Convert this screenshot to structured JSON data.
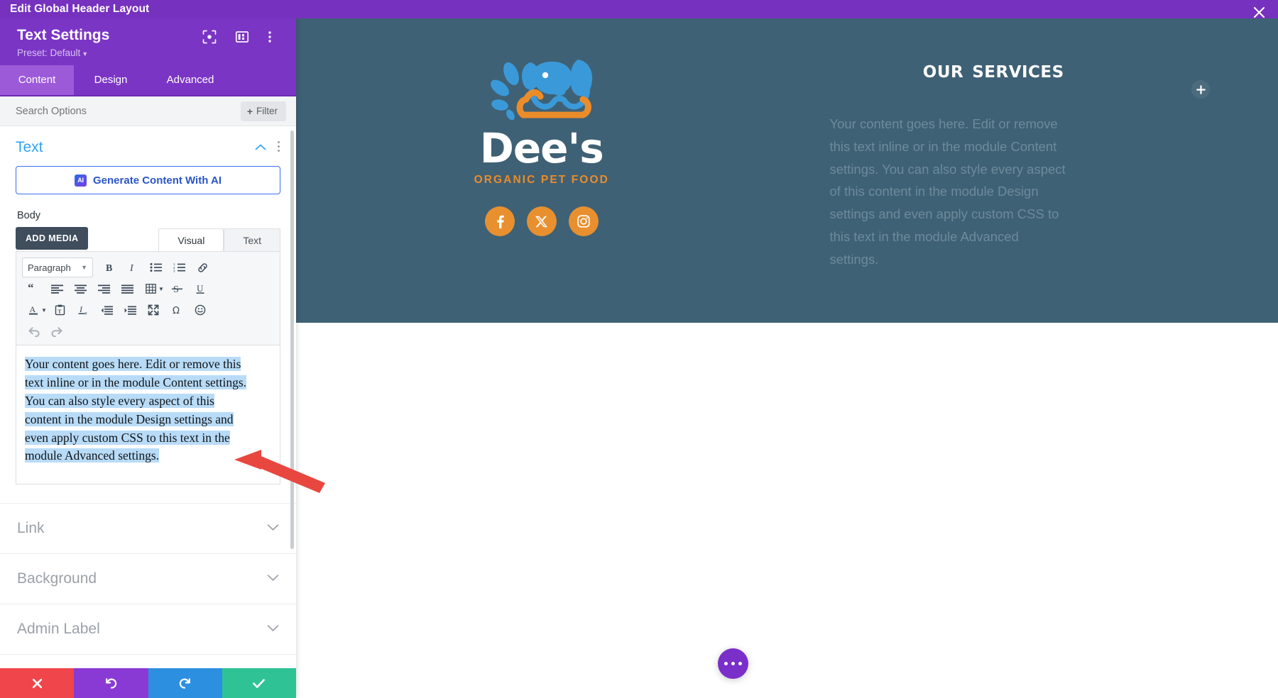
{
  "window": {
    "title": "Edit Global Header Layout",
    "close_icon": "close-icon"
  },
  "panel": {
    "module_title": "Text Settings",
    "preset_label": "Preset: Default",
    "header_icons": [
      "target-icon",
      "layout-columns-icon",
      "kebab-menu-icon"
    ],
    "tabs": [
      {
        "label": "Content",
        "active": true
      },
      {
        "label": "Design",
        "active": false
      },
      {
        "label": "Advanced",
        "active": false
      }
    ],
    "search": {
      "placeholder": "Search Options",
      "filter_label": "Filter"
    },
    "section": {
      "title": "Text",
      "collapse_icon": "chevron-up-icon",
      "options_icon": "kebab-menu-icon"
    },
    "ai_button": {
      "badge": "AI",
      "label": "Generate Content With AI"
    },
    "body_label": "Body",
    "editor": {
      "add_media_label": "ADD MEDIA",
      "tabs": [
        {
          "label": "Visual",
          "selected": true
        },
        {
          "label": "Text",
          "selected": false
        }
      ],
      "format_select": "Paragraph",
      "toolbar_row1": [
        "bold-icon",
        "italic-icon",
        "bulleted-list-icon",
        "numbered-list-icon",
        "link-icon"
      ],
      "toolbar_row2": [
        "blockquote-icon",
        "align-left-icon",
        "align-center-icon",
        "align-right-icon",
        "align-justify-icon",
        "table-icon",
        "strikethrough-icon",
        "underline-icon"
      ],
      "toolbar_row3": [
        "text-color-icon",
        "paste-as-text-icon",
        "clear-formatting-icon",
        "outdent-icon",
        "indent-icon",
        "fullscreen-icon",
        "special-character-icon",
        "emoji-icon"
      ],
      "toolbar_row4": [
        "undo-icon",
        "redo-icon"
      ],
      "content": "Your content goes here. Edit or remove this text inline or in the module Content settings. You can also style every aspect of this content in the module Design settings and even apply custom CSS to this text in the module Advanced settings."
    },
    "accordion": [
      {
        "label": "Link",
        "icon": "chevron-down-icon"
      },
      {
        "label": "Background",
        "icon": "chevron-down-icon"
      },
      {
        "label": "Admin Label",
        "icon": "chevron-down-icon"
      }
    ],
    "footer": [
      {
        "name": "cancel",
        "icon": "x-icon",
        "color": "#f0454b"
      },
      {
        "name": "undo",
        "icon": "undo-icon",
        "color": "#8a3ad4"
      },
      {
        "name": "redo",
        "icon": "redo-icon",
        "color": "#2d8fe0"
      },
      {
        "name": "save",
        "icon": "check-icon",
        "color": "#2fc295"
      }
    ]
  },
  "canvas": {
    "hero_bg": "#3f6175",
    "logo": {
      "wordmark": "Dee's",
      "tagline": "ORGANIC PET FOOD",
      "accent": "#eb8c2a",
      "mark_color": "#3a9ad9"
    },
    "socials": [
      {
        "name": "facebook",
        "glyph": "f"
      },
      {
        "name": "x-twitter",
        "glyph": "X"
      },
      {
        "name": "instagram",
        "glyph": "camera"
      }
    ],
    "services": {
      "title": "Our Services",
      "body": "Your content goes here. Edit or remove this text inline or in the module Content settings. You can also style every aspect of this content in the module Design settings and even apply custom CSS to this text in the module Advanced settings."
    },
    "add_module_icon": "plus-icon",
    "fab_icon": "ellipsis-icon"
  }
}
